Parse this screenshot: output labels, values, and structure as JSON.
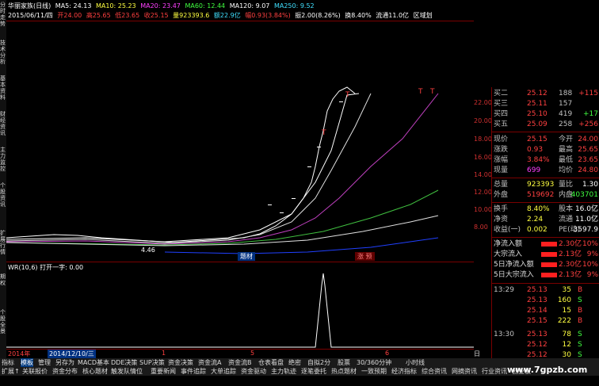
{
  "left_tabs": [
    "分时走势",
    "技术分析",
    "基本资料",
    "财经资讯",
    "主力监控",
    "个股资讯",
    "扩展行情",
    "期权",
    "个股全景"
  ],
  "header": {
    "stock_title": "华丽家族(日线)",
    "ma5": "MA5: 24.13",
    "ma10": "MA10: 25.23",
    "ma20": "MA20: 23.47",
    "ma60": "MA60: 12.44",
    "ma120": "MA120: 9.07",
    "ma250": "MA250: 9.52",
    "date": "2015/06/11/四",
    "open": "开24.00",
    "high": "高25.65",
    "low": "低23.65",
    "close": "收25.15",
    "vol": "量923393.6",
    "amount": "额22.9亿",
    "change": "幅0.93(3.84%)",
    "amplitude": "振2.00(8.26%)",
    "turnover": "换8.40%",
    "float": "流通11.0亿",
    "region": "区域划"
  },
  "price_ticks": [
    "22.00",
    "20.00",
    "18.00",
    "16.00",
    "14.00",
    "12.00",
    "10.00",
    "8.00"
  ],
  "chart_labels": {
    "low_mark": "4.46",
    "marker_left": "题材",
    "marker_right": "涨  预"
  },
  "indicator": {
    "name": "WR(10,6)",
    "label": "打开一字: 0.00"
  },
  "quotes": [
    {
      "label": "买二",
      "price": "25.12",
      "vol": "188",
      "delta": "+115"
    },
    {
      "label": "买三",
      "price": "25.11",
      "vol": "157",
      "delta": ""
    },
    {
      "label": "买四",
      "price": "25.10",
      "vol": "419",
      "delta": "+17"
    },
    {
      "label": "买五",
      "price": "25.09",
      "vol": "258",
      "delta": "+256"
    }
  ],
  "stats": [
    {
      "l1": "现价",
      "v1": "25.15",
      "l2": "今开",
      "v2": "24.00"
    },
    {
      "l1": "涨跌",
      "v1": "0.93",
      "l2": "最高",
      "v2": "25.65"
    },
    {
      "l1": "涨幅",
      "v1": "3.84%",
      "l2": "最低",
      "v2": "23.65"
    },
    {
      "l1": "现量",
      "v1": "699",
      "l2": "均价",
      "v2": "24.80"
    },
    {
      "l1": "总量",
      "v1": "923393",
      "l2": "量比",
      "v2": "1.30"
    },
    {
      "l1": "外盘",
      "v1": "519692",
      "l2": "内盘",
      "v2": "403701"
    },
    {
      "l1": "换手",
      "v1": "8.40%",
      "l2": "股本",
      "v2": "16.0亿"
    },
    {
      "l1": "净资",
      "v1": "2.24",
      "l2": "流通",
      "v2": "11.0亿"
    },
    {
      "l1": "收益(一)",
      "v1": "0.002",
      "l2": "PE(动)",
      "v2": "3597.9"
    }
  ],
  "flows": [
    {
      "label": "净流入额",
      "value": "2.30亿",
      "pct": "10%"
    },
    {
      "label": "大宗流入",
      "value": "2.13亿",
      "pct": "9%"
    },
    {
      "label": "5日净流入额",
      "value": "2.30亿",
      "pct": "10%"
    },
    {
      "label": "5日大宗流入",
      "value": "2.13亿",
      "pct": "9%"
    }
  ],
  "ticks": [
    {
      "time": "13:29",
      "price": "25.13",
      "vol": "35",
      "bs": "B"
    },
    {
      "time": "",
      "price": "25.13",
      "vol": "160",
      "bs": "S"
    },
    {
      "time": "",
      "price": "25.14",
      "vol": "15",
      "bs": "B"
    },
    {
      "time": "",
      "price": "25.15",
      "vol": "222",
      "bs": "B"
    },
    {
      "time": "13:30",
      "price": "25.13",
      "vol": "78",
      "bs": "S"
    },
    {
      "time": "",
      "price": "25.12",
      "vol": "12",
      "bs": "S"
    },
    {
      "time": "",
      "price": "25.12",
      "vol": "30",
      "bs": "S"
    }
  ],
  "date_bar": {
    "year": "2014年",
    "date": "2014/12/10/三",
    "m1": "1",
    "m5": "5",
    "m6": "6",
    "day": "日线"
  },
  "toolbar1": [
    "指标",
    "模板",
    "管理",
    "另存为",
    "MACD基本",
    "DDE决策",
    "SUP决策",
    "资金决策",
    "资金流A",
    "资金流B",
    "仓表看盘",
    "绝密",
    "自拟2分",
    "股票",
    "30/360分钟",
    "小时线"
  ],
  "toolbar2": [
    "扩展↑",
    "关联报价",
    "资金分布",
    "核心题材",
    "触发队情位",
    "重要新闻",
    "事件追踪",
    "大单追踪",
    "资金驱动",
    "主力轨迹",
    "逐笔委托",
    "热点题材",
    "一致预期",
    "经济指标",
    "综合资讯",
    "网摘资讯",
    "行业资讯",
    "创业板"
  ],
  "watermark": "www.7gpzb.com"
}
